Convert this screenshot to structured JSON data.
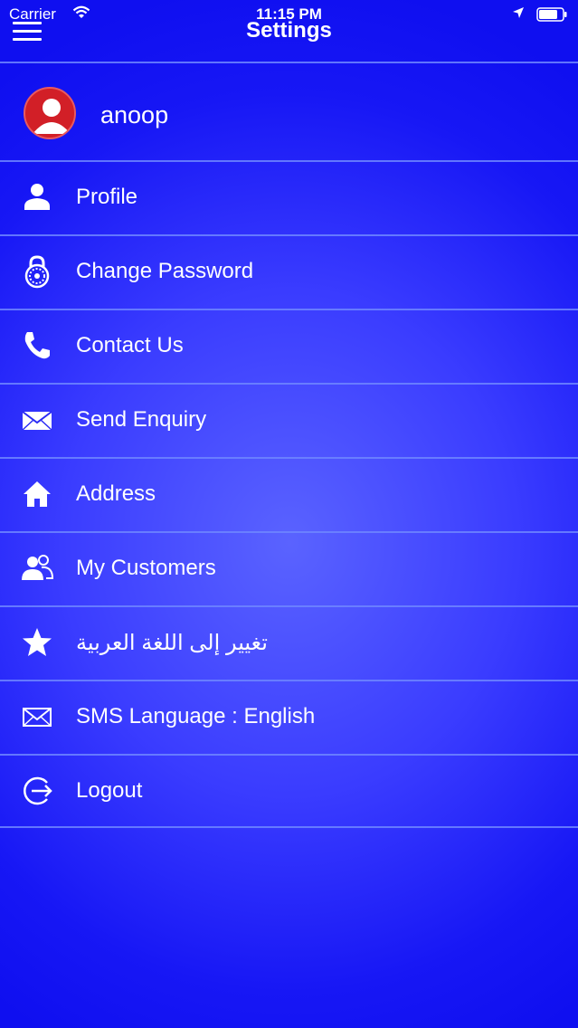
{
  "status": {
    "carrier": "Carrier",
    "time": "11:15 PM"
  },
  "header": {
    "title": "Settings"
  },
  "user": {
    "name": "anoop"
  },
  "menu": [
    {
      "label": "Profile",
      "icon": "person-icon"
    },
    {
      "label": "Change Password",
      "icon": "lock-icon"
    },
    {
      "label": "Contact Us",
      "icon": "phone-icon"
    },
    {
      "label": "Send Enquiry",
      "icon": "envelope-icon"
    },
    {
      "label": "Address",
      "icon": "home-icon"
    },
    {
      "label": "My Customers",
      "icon": "users-icon"
    },
    {
      "label": "تغيير إلى اللغة العربية",
      "icon": "star-icon"
    },
    {
      "label": "SMS Language : English",
      "icon": "mail-outline-icon"
    },
    {
      "label": "Logout",
      "icon": "logout-icon"
    }
  ],
  "colors": {
    "background": "#1a1af5",
    "divider": "#6f86ff",
    "avatar": "#d21f27"
  }
}
